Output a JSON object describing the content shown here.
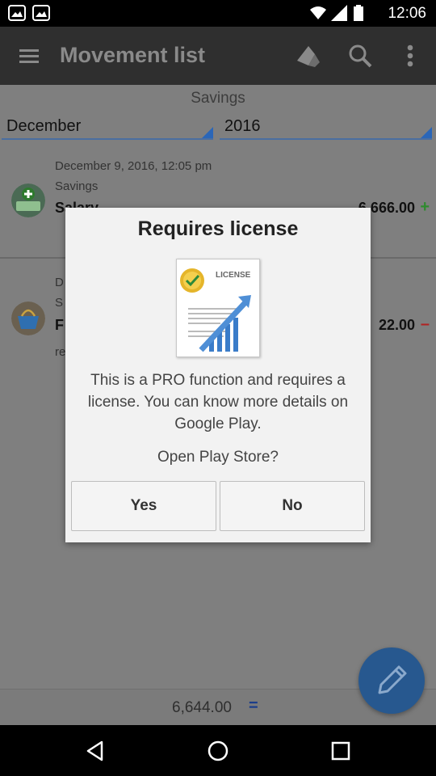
{
  "status_bar": {
    "time": "12:06"
  },
  "toolbar": {
    "title": "Movement list"
  },
  "filters": {
    "account": "Savings",
    "month": "December",
    "year": "2016"
  },
  "movements": [
    {
      "date": "December 9,  2016, 12:05 pm",
      "account": "Savings",
      "title": "Salary",
      "amount": "6,666.00",
      "sign": "+"
    },
    {
      "date": "D",
      "account": "S",
      "title": "F",
      "amount": "22.00",
      "sign": "–",
      "note": "re"
    }
  ],
  "total": {
    "amount": "6,644.00",
    "symbol": "="
  },
  "dialog": {
    "title": "Requires license",
    "image_label": "LICENSE",
    "message": "This is a PRO function and requires a license. You can know more details on Google Play.",
    "question": "Open Play Store?",
    "yes_label": "Yes",
    "no_label": "No"
  },
  "colors": {
    "plus": "#2e8b2e",
    "minus": "#b22222",
    "accent": "#2a66b8"
  }
}
